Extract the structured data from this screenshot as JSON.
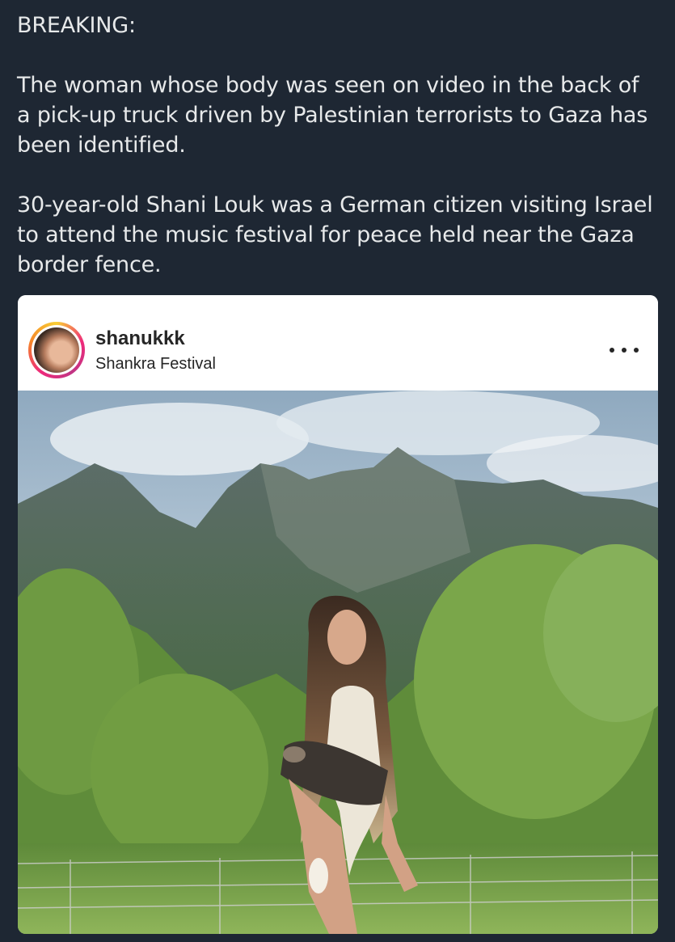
{
  "tweet": {
    "line1": "BREAKING:",
    "paragraph1_lines": [
      "The woman whose body was seen on video in the back of",
      "a pick-up truck driven by Palestinian terrorists to Gaza has",
      "been identified."
    ],
    "paragraph2_lines": [
      "30-year-old Shani Louk was a German citizen visiting Israel",
      "to attend the music festival for peace held near the Gaza",
      "border fence."
    ]
  },
  "embed": {
    "username": "shanukkk",
    "location": "Shankra Festival",
    "more_icon": "more-horizontal-icon"
  },
  "colors": {
    "page_background": "#1e2733",
    "text": "#e7e9ea",
    "card_background": "#ffffff",
    "card_text": "#262626"
  }
}
